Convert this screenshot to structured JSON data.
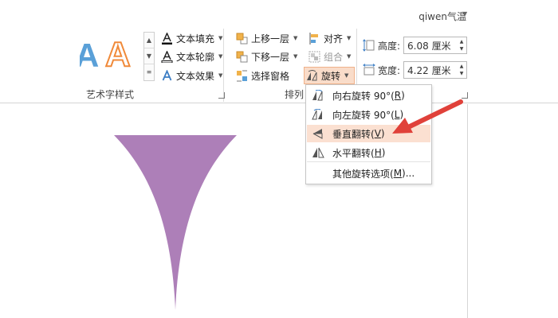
{
  "user": {
    "name": "qiwen气温"
  },
  "wordart": {
    "gallery_glyph": "A",
    "commands": {
      "fill": "文本填充",
      "outline": "文本轮廓",
      "effects": "文本效果"
    },
    "group_label": "艺术字样式"
  },
  "arrange": {
    "bring_forward": "上移一层",
    "send_backward": "下移一层",
    "selection_pane": "选择窗格",
    "align": "对齐",
    "group": "组合",
    "rotate": "旋转",
    "group_label": "排列"
  },
  "size": {
    "height_label": "高度:",
    "height_value": "6.08 厘米",
    "width_label": "宽度:",
    "width_value": "4.22 厘米"
  },
  "rotate_menu": {
    "items": [
      {
        "label": "向右旋转 90°(",
        "key": "R",
        "suffix": ")"
      },
      {
        "label": "向左旋转 90°(",
        "key": "L",
        "suffix": ")"
      },
      {
        "label": "垂直翻转(",
        "key": "V",
        "suffix": ")"
      },
      {
        "label": "水平翻转(",
        "key": "H",
        "suffix": ")"
      },
      {
        "label": "其他旋转选项(",
        "key": "M",
        "suffix": ")..."
      }
    ],
    "highlighted_index": 2
  },
  "colors": {
    "shape_fill": "#ad7fb8",
    "highlight": "#fbe0d1",
    "annotation_arrow": "#e0413a",
    "wordart_orange": "#f08a3a",
    "wordart_blue": "#5aa0d8"
  }
}
